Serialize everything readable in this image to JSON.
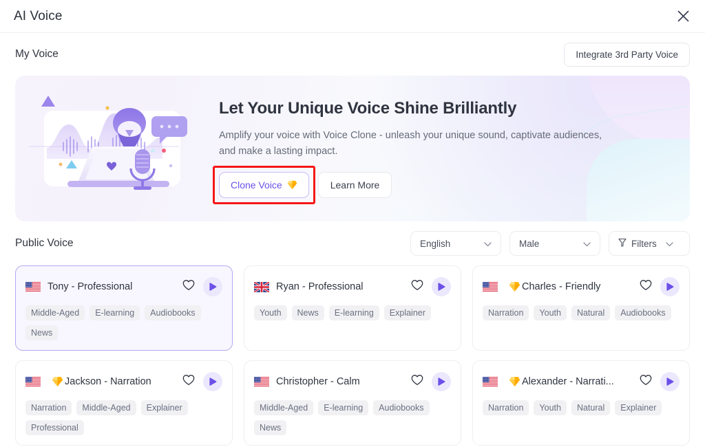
{
  "window": {
    "title": "AI Voice",
    "close_icon": "close-icon"
  },
  "my_voice": {
    "title": "My Voice",
    "integrate_button": "Integrate 3rd Party Voice"
  },
  "banner": {
    "heading": "Let Your Unique Voice Shine Brilliantly",
    "description": "Amplify your voice with Voice Clone - unleash your unique sound, captivate audiences, and make a lasting impact.",
    "clone_button": "Clone Voice",
    "clone_button_icon": "gem-icon",
    "learn_button": "Learn More",
    "highlight_color": "#f51717",
    "accent_color": "#6c50e8"
  },
  "public_voice": {
    "title": "Public Voice",
    "filters": {
      "language": "English",
      "gender": "Male",
      "filters_label": "Filters"
    },
    "cards": [
      {
        "name": "Tony - Professional",
        "flag": "us",
        "premium": false,
        "selected": true,
        "tags": [
          "Middle-Aged",
          "E-learning",
          "Audiobooks",
          "News"
        ]
      },
      {
        "name": "Ryan - Professional",
        "flag": "uk",
        "premium": false,
        "selected": false,
        "tags": [
          "Youth",
          "News",
          "E-learning",
          "Explainer"
        ]
      },
      {
        "name": "Charles - Friendly",
        "flag": "us",
        "premium": true,
        "selected": false,
        "tags": [
          "Narration",
          "Youth",
          "Natural",
          "Audiobooks"
        ]
      },
      {
        "name": "Jackson - Narration",
        "flag": "us",
        "premium": true,
        "selected": false,
        "tags": [
          "Narration",
          "Middle-Aged",
          "Explainer",
          "Professional"
        ]
      },
      {
        "name": "Christopher - Calm",
        "flag": "us",
        "premium": false,
        "selected": false,
        "tags": [
          "Middle-Aged",
          "E-learning",
          "Audiobooks",
          "News"
        ]
      },
      {
        "name": "Alexander - Narrati...",
        "flag": "us",
        "premium": true,
        "selected": false,
        "tags": [
          "Narration",
          "Youth",
          "Natural",
          "Explainer"
        ]
      }
    ]
  }
}
